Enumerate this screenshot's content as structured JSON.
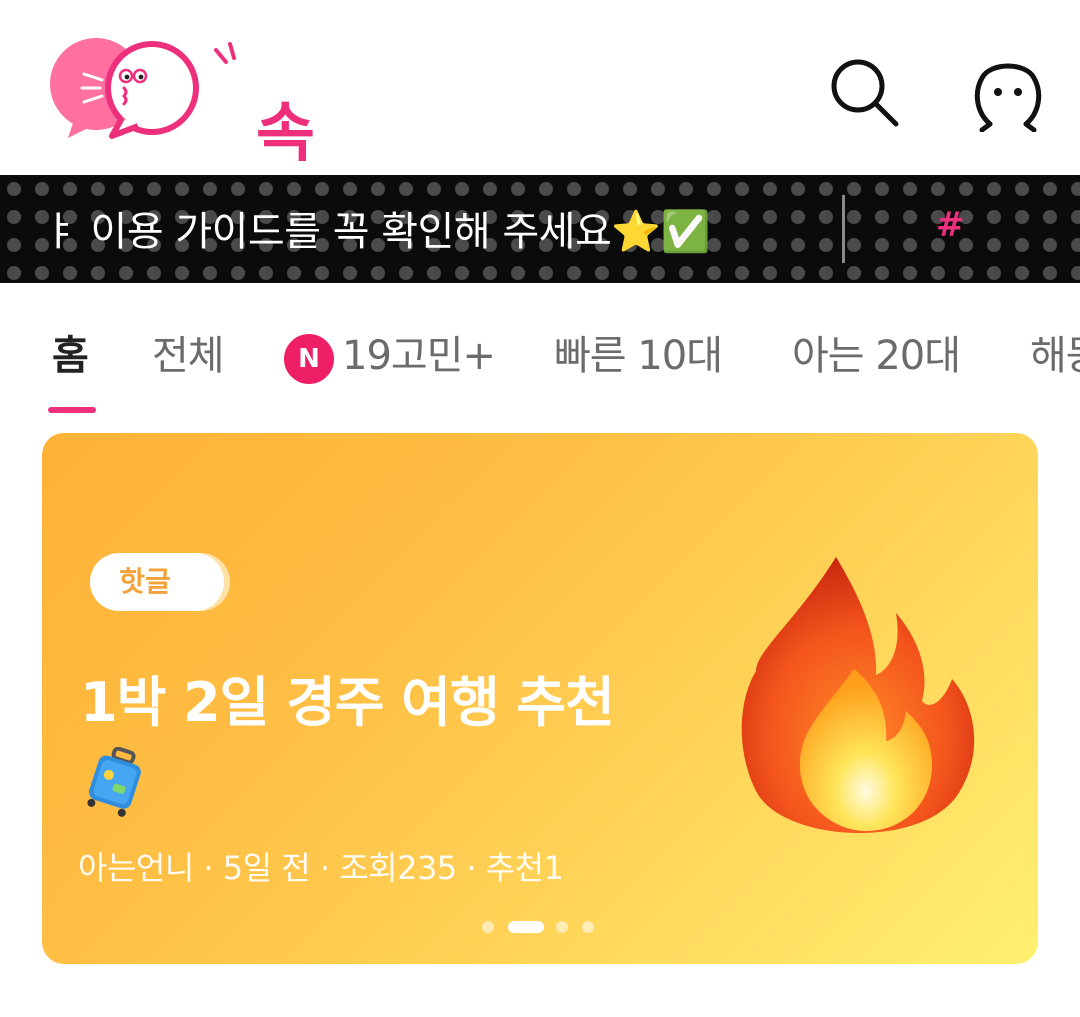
{
  "app": {
    "logo_text": "속닥"
  },
  "header": {
    "search_icon": "search-icon",
    "profile_icon": "profile-icon"
  },
  "ticker": {
    "text": "ㅑ 이용 가이드를 꼭 확인해 주세요⭐✅",
    "hash": "#"
  },
  "tabs": [
    {
      "label": "홈",
      "active": true
    },
    {
      "label": "전체",
      "active": false
    },
    {
      "label": "19고민+",
      "badge": "N",
      "active": false
    },
    {
      "label": "빠른 10대",
      "active": false
    },
    {
      "label": "아는 20대",
      "active": false
    },
    {
      "label": "해몽",
      "active": false
    }
  ],
  "banner": {
    "tag": "핫글",
    "title": "1박 2일 경주 여행 추천",
    "meta": "아는언니 · 5일 전 · 조회235 · 추천1",
    "pagination": {
      "total": 4,
      "current": 2
    }
  },
  "colors": {
    "brand": "#ee2f7c",
    "banner_start": "#ffb137",
    "banner_end": "#fff070"
  }
}
